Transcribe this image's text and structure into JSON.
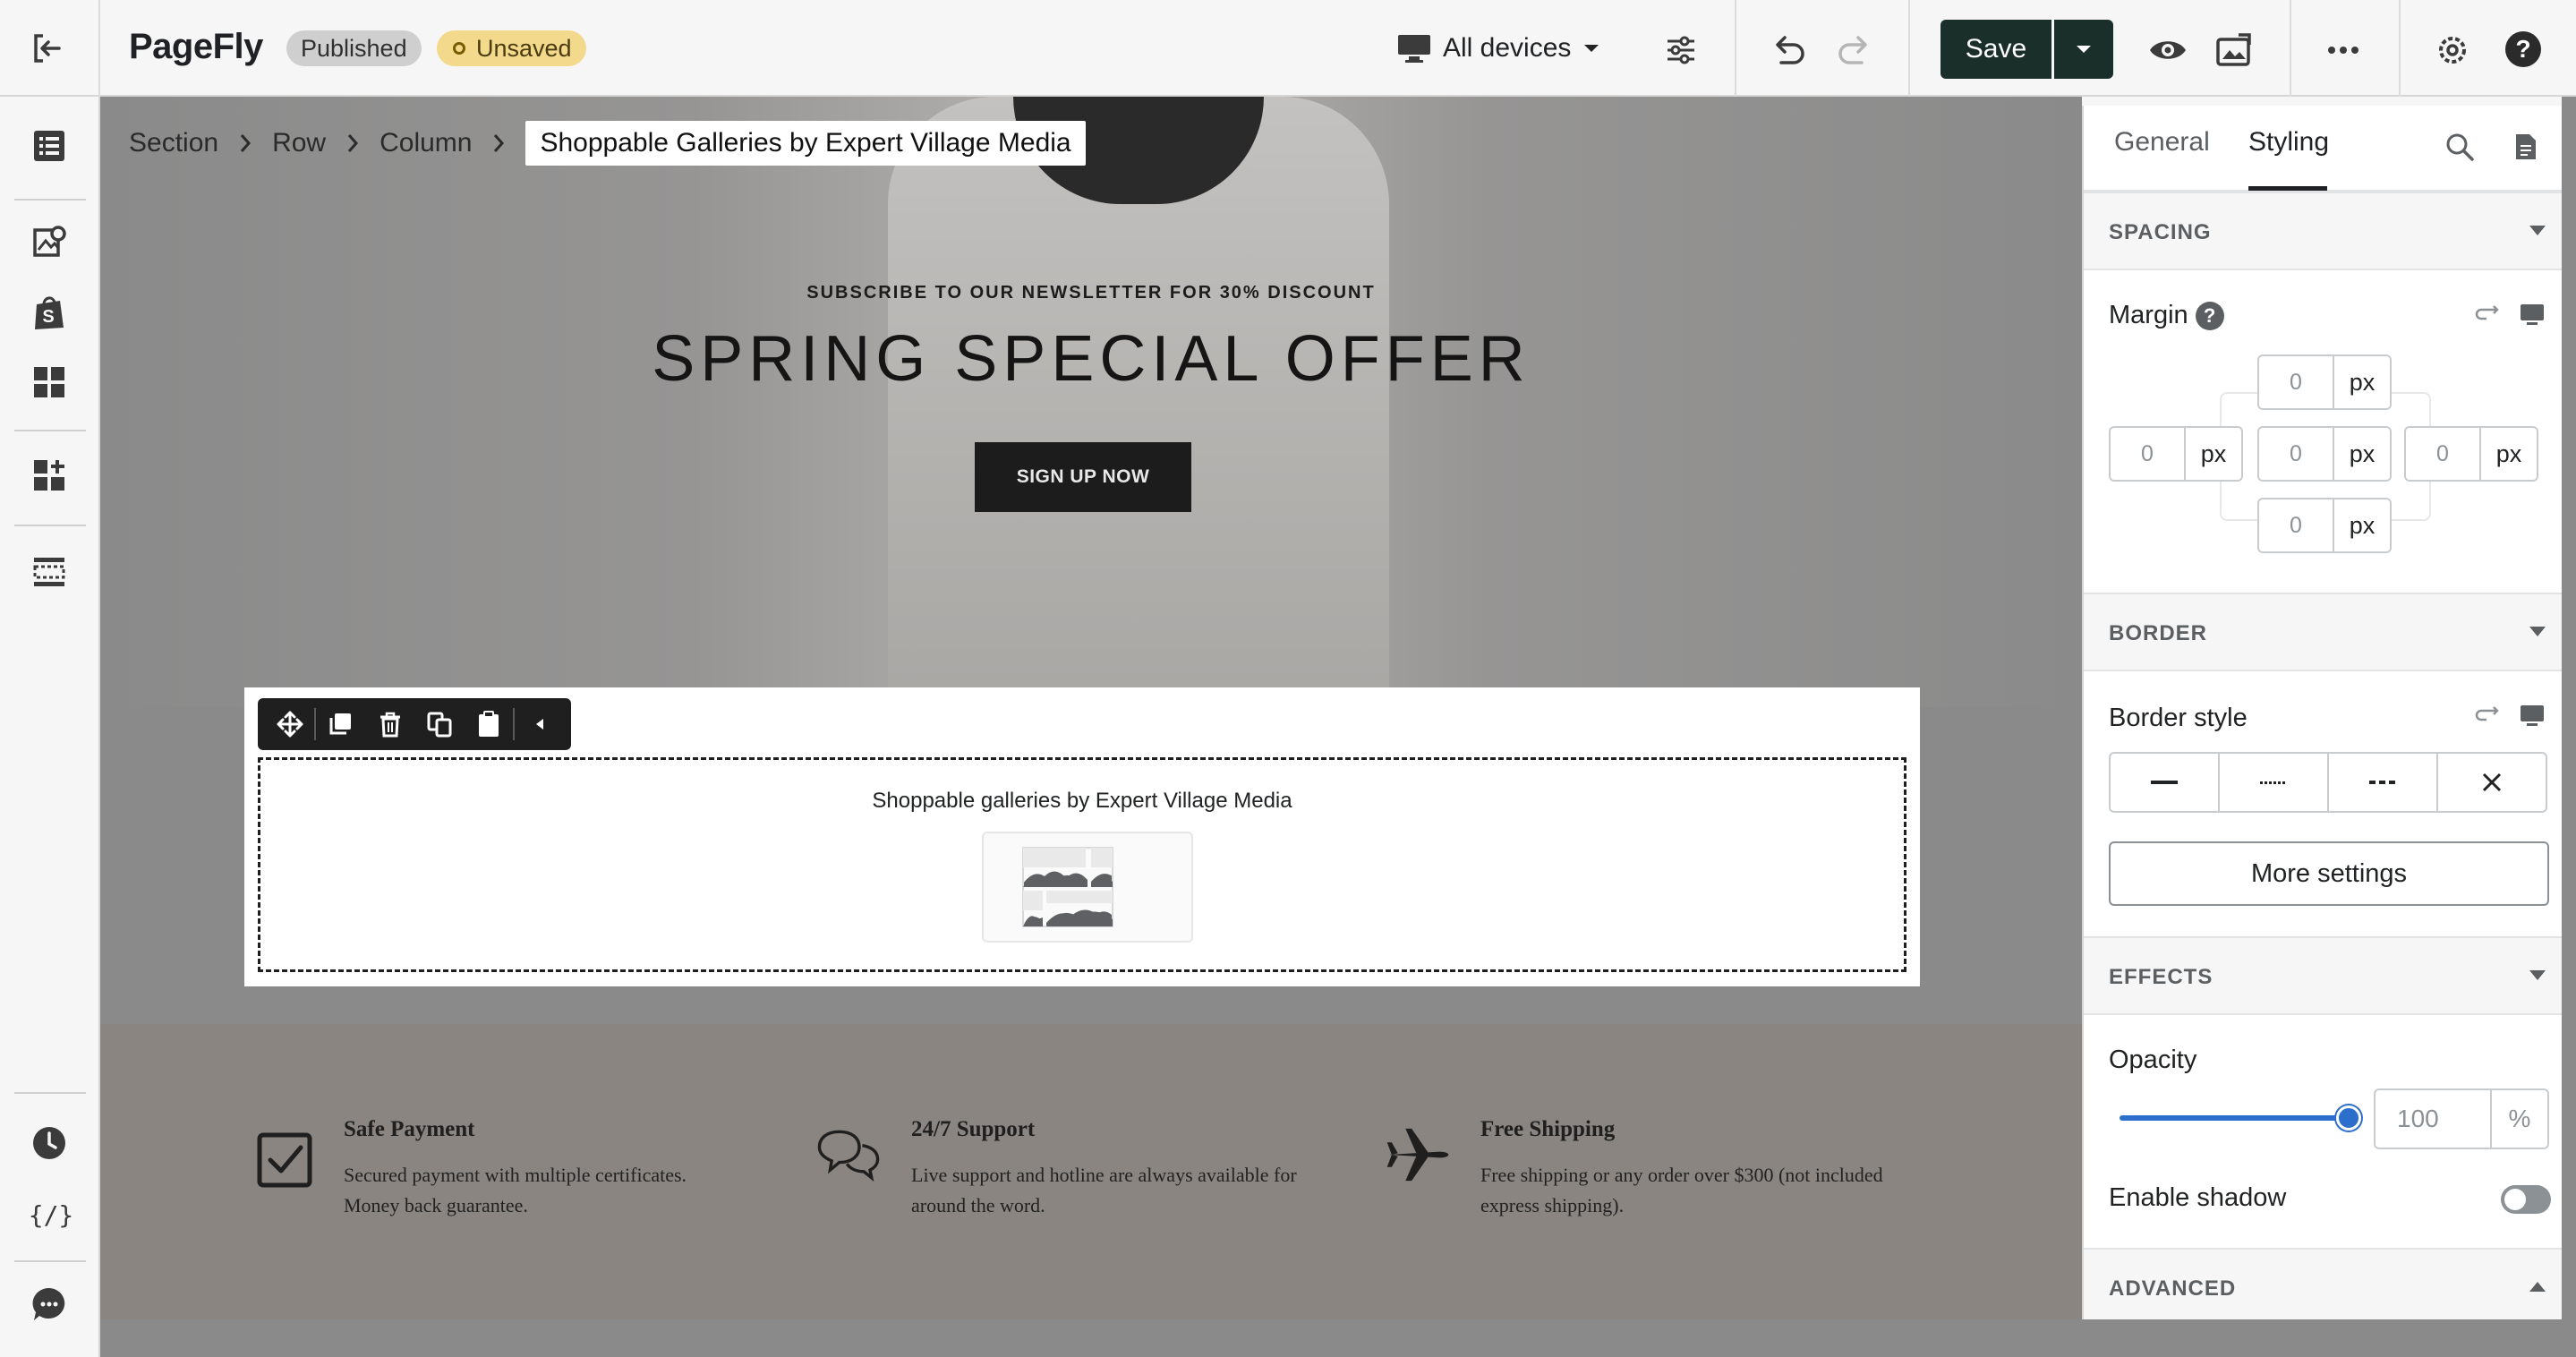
{
  "app": {
    "logo": "PageFly",
    "status_published": "Published",
    "status_unsaved": "Unsaved"
  },
  "toolbar": {
    "devices_label": "All devices",
    "save_label": "Save"
  },
  "breadcrumb": {
    "items": [
      "Section",
      "Row",
      "Column"
    ],
    "current": "Shoppable Galleries by Expert Village Media"
  },
  "hero": {
    "subtitle": "SUBSCRIBE TO OUR NEWSLETTER FOR 30% DISCOUNT",
    "title": "SPRING SPECIAL OFFER",
    "button": "SIGN UP NOW"
  },
  "selected_element": {
    "title": "Shoppable galleries by Expert Village Media"
  },
  "features": [
    {
      "title": "Safe Payment",
      "text": "Secured payment with multiple certificates. Money back guarantee.",
      "icon": "checkbox-icon"
    },
    {
      "title": "24/7 Support",
      "text": "Live support and hotline are always available for around the word.",
      "icon": "chat-bubbles-icon"
    },
    {
      "title": "Free Shipping",
      "text": "Free shipping or any order over $300 (not included express shipping).",
      "icon": "airplane-icon"
    }
  ],
  "panel": {
    "tabs": [
      "General",
      "Styling"
    ],
    "active_tab": "Styling",
    "spacing": {
      "header": "SPACING",
      "margin_label": "Margin",
      "margin_help": "?",
      "top": "0",
      "left": "0",
      "center": "0",
      "right": "0",
      "bottom": "0",
      "unit": "px"
    },
    "border": {
      "header": "BORDER",
      "style_label": "Border style",
      "more_settings": "More settings"
    },
    "effects": {
      "header": "EFFECTS",
      "opacity_label": "Opacity",
      "opacity_value": "100",
      "opacity_unit": "%",
      "opacity_level": 1.0,
      "shadow_label": "Enable shadow",
      "shadow_enabled": false
    },
    "advanced": {
      "header": "ADVANCED"
    }
  },
  "colors": {
    "save_button": "#1a2e2a",
    "slider_accent": "#2c6ecb",
    "unsaved_badge": "#f2d98c"
  }
}
